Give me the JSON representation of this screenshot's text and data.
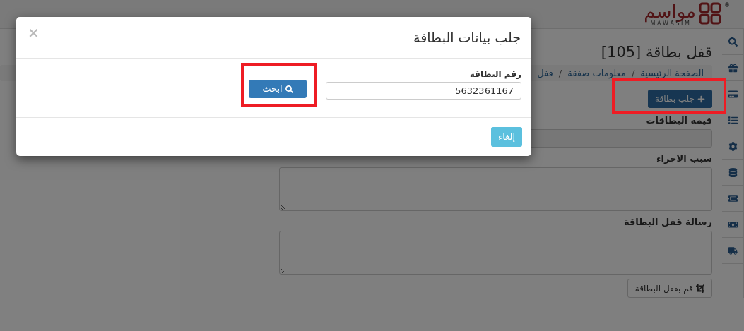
{
  "header": {
    "logo": {
      "name": "مواسم",
      "latin": "M A W A S I M",
      "mark": "®"
    }
  },
  "page": {
    "title": "قفل بطاقة [105]",
    "breadcrumb": [
      {
        "label": "الصفحة الرئيسية",
        "separator": "/"
      },
      {
        "label": "معلومات صفقة",
        "separator": "/"
      },
      {
        "label": "قفل"
      }
    ],
    "fetch_button": {
      "label": "جلب بطاقة",
      "highlighted": true
    },
    "fields": [
      {
        "kind": "readonly",
        "label": "قيمة البطاقات"
      },
      {
        "kind": "textarea",
        "label": "سبب الاجراء"
      },
      {
        "kind": "textarea",
        "label": "رسالة قفل البطاقة"
      }
    ],
    "lock_button": {
      "label": "قم بقفل البطاقة"
    }
  },
  "modal": {
    "title": "جلب بيانات البطاقة",
    "close": "×",
    "field": {
      "label": "رقم البطاقة",
      "value": "5632361167"
    },
    "search_button": {
      "label": "ابحث",
      "highlighted": true
    },
    "cancel_button": {
      "label": "إلغاء"
    }
  }
}
